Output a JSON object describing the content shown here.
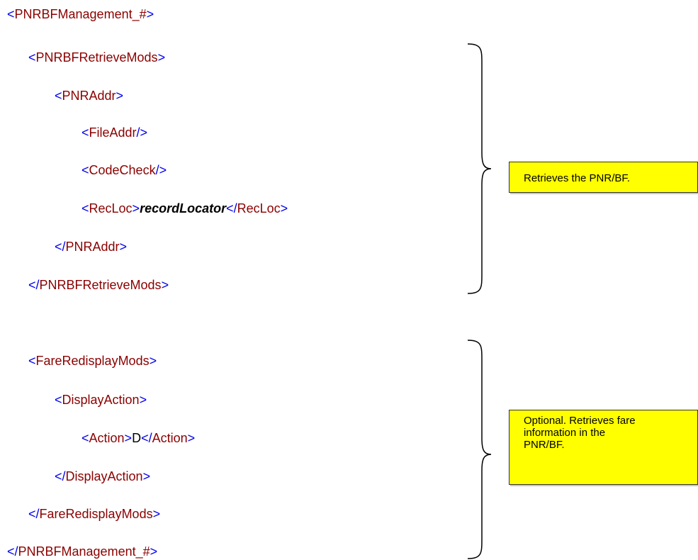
{
  "xml_lines": [
    {
      "open": "<",
      "tag": "PNRBFManagement_#",
      "close": ">"
    },
    {
      "open": "<",
      "tag": "PNRBFRetrieveMods",
      "close": ">"
    },
    {
      "open": "<",
      "tag": "PNRAddr",
      "close": ">"
    },
    {
      "open": "<",
      "tag": "FileAddr",
      "close": "/>"
    },
    {
      "open": "<",
      "tag": "CodeCheck",
      "close": "/>"
    },
    {
      "open": "<",
      "tag": "RecLoc",
      "close": ">",
      "content": "recordLocator",
      "end_open": "</",
      "end_tag": "RecLoc",
      "end_close": ">"
    },
    {
      "open": "</",
      "tag": "PNRAddr",
      "close": ">"
    },
    {
      "open": "</",
      "tag": "PNRBFRetrieveMods",
      "close": ">"
    },
    {
      "open": "<",
      "tag": "FareRedisplayMods",
      "close": ">"
    },
    {
      "open": "<",
      "tag": "DisplayAction",
      "close": ">"
    },
    {
      "open": "<",
      "tag": "Action",
      "close": ">",
      "content": "D",
      "end_open": "</",
      "end_tag": "Action",
      "end_close": ">"
    },
    {
      "open": "</",
      "tag": "DisplayAction",
      "close": ">"
    },
    {
      "open": "</",
      "tag": "FareRedisplayMods",
      "close": ">"
    },
    {
      "open": "</",
      "tag": "PNRBFManagement_#",
      "close": ">"
    }
  ],
  "notes": {
    "retrieve": "Retrieves the PNR/BF.",
    "fare": "Optional. Retrieves fare information in the PNR/BF."
  },
  "colors": {
    "bracket": "#0000ee",
    "tag_name": "#8b0000",
    "note_background": "#ffff00"
  }
}
